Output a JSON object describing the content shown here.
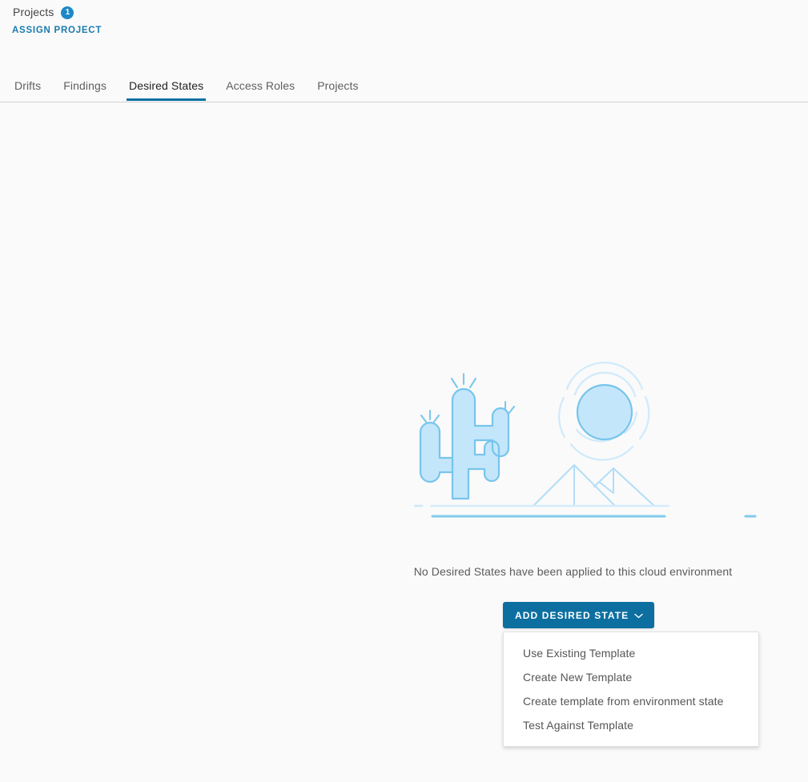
{
  "header": {
    "projects_label": "Projects",
    "projects_count": "1",
    "assign_link": "ASSIGN PROJECT"
  },
  "tabs": [
    {
      "label": "Drifts",
      "active": false
    },
    {
      "label": "Findings",
      "active": false
    },
    {
      "label": "Desired States",
      "active": true
    },
    {
      "label": "Access Roles",
      "active": false
    },
    {
      "label": "Projects",
      "active": false
    }
  ],
  "empty_state": {
    "illustration_name": "desert-cactus-sun-pyramids-illustration",
    "message": "No Desired States have been applied to this cloud environment"
  },
  "add_button": {
    "label": "ADD DESIRED STATE",
    "chevron": "chevron-down-icon"
  },
  "menu": {
    "items": [
      "Use Existing Template",
      "Create New Template",
      "Create template from environment state",
      "Test Against Template"
    ]
  },
  "colors": {
    "page_bg": "#fafafa",
    "accent_blue": "#0d6fa0",
    "link_blue": "#1a7aad",
    "badge_blue": "#1e88c7",
    "tab_underline": "#0770a2",
    "illustration_fill": "#bfe4fb",
    "illustration_stroke": "#6fc4ee",
    "illustration_light": "#cfe9fb"
  }
}
